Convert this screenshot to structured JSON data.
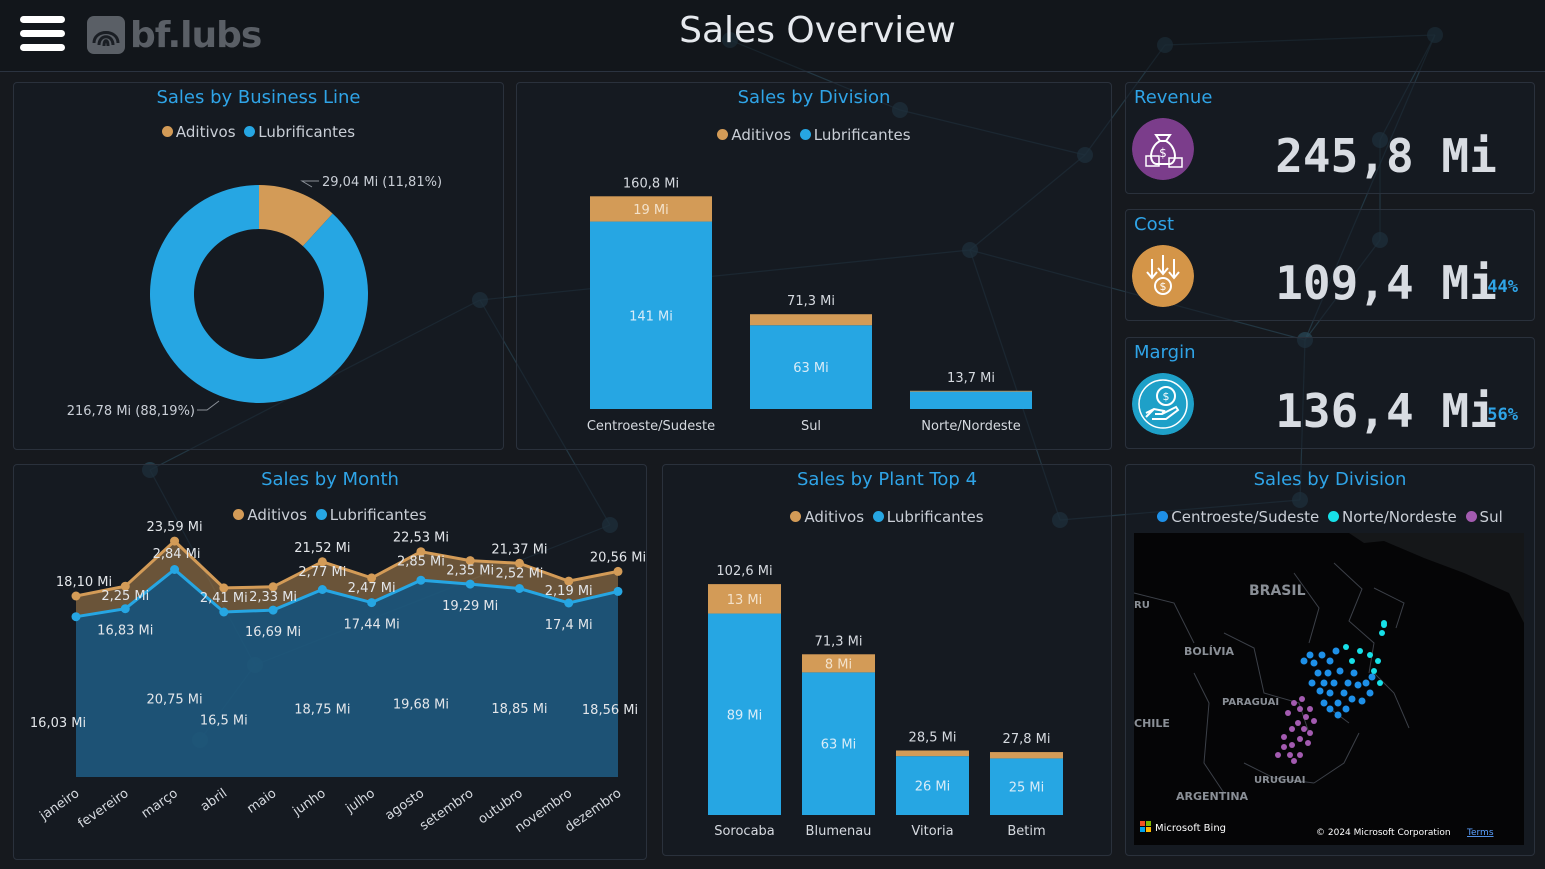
{
  "header": {
    "brand": "bf.lubs",
    "title": "Sales Overview"
  },
  "colors": {
    "aditivos": "#d39b57",
    "lubrificantes": "#26a6e3",
    "centroeste": "#1e90e8",
    "norte": "#17e0e8",
    "sul": "#a35bb0",
    "accent": "#2fa4e7",
    "revenue_icon": "#7b3d8b",
    "cost_icon": "#d49548",
    "margin_icon": "#1ea0c8"
  },
  "panels": {
    "business_line": {
      "title": "Sales by Business Line",
      "legend": [
        "Aditivos",
        "Lubrificantes"
      ]
    },
    "division_bar": {
      "title": "Sales by Division",
      "legend": [
        "Aditivos",
        "Lubrificantes"
      ]
    },
    "month": {
      "title": "Sales by Month",
      "legend": [
        "Aditivos",
        "Lubrificantes"
      ]
    },
    "plant": {
      "title": "Sales by Plant Top 4",
      "legend": [
        "Aditivos",
        "Lubrificantes"
      ]
    },
    "division_map": {
      "title": "Sales by Division",
      "legend": [
        "Centroeste/Sudeste",
        "Norte/Nordeste",
        "Sul"
      ],
      "labels": [
        "BRASIL",
        "BOLÍVIA",
        "PARAGUAI",
        "CHILE",
        "URUGUAI",
        "ARGENTINA",
        "RU"
      ],
      "brand": "Microsoft Bing",
      "copyright": "© 2024 Microsoft Corporation",
      "terms": "Terms"
    }
  },
  "kpis": {
    "revenue": {
      "title": "Revenue",
      "value": "245,8 Mi",
      "icon": "money-bag-icon"
    },
    "cost": {
      "title": "Cost",
      "value": "109,4 Mi",
      "pct": "44%",
      "icon": "coin-arrows-icon"
    },
    "margin": {
      "title": "Margin",
      "value": "136,4 Mi",
      "pct": "56%",
      "icon": "hand-coin-icon"
    }
  },
  "chart_data": [
    {
      "id": "business_line",
      "type": "pie",
      "title": "Sales by Business Line",
      "series": [
        {
          "name": "Aditivos",
          "value": 29.04,
          "label": "29,04 Mi (11,81%)"
        },
        {
          "name": "Lubrificantes",
          "value": 216.78,
          "label": "216,78 Mi (88,19%)"
        }
      ]
    },
    {
      "id": "division_bar",
      "type": "bar",
      "title": "Sales by Division",
      "categories": [
        "Centroeste/Sudeste",
        "Sul",
        "Norte/Nordeste"
      ],
      "series": [
        {
          "name": "Lubrificantes",
          "values": [
            141,
            63,
            13.1
          ],
          "labels": [
            "141 Mi",
            "63 Mi",
            ""
          ]
        },
        {
          "name": "Aditivos",
          "values": [
            19,
            8.3,
            0.6
          ],
          "labels": [
            "19 Mi",
            "",
            ""
          ]
        }
      ],
      "totals": [
        "160,8 Mi",
        "71,3 Mi",
        "13,7 Mi"
      ],
      "ylim": [
        0,
        170
      ]
    },
    {
      "id": "month",
      "type": "area",
      "title": "Sales by Month",
      "categories": [
        "janeiro",
        "fevereiro",
        "março",
        "abril",
        "maio",
        "junho",
        "julho",
        "agosto",
        "setembro",
        "outubro",
        "novembro",
        "dezembro"
      ],
      "series": [
        {
          "name": "Lubrificantes",
          "values": [
            16.03,
            16.83,
            20.75,
            16.5,
            16.69,
            18.75,
            17.44,
            19.68,
            19.29,
            18.85,
            17.4,
            18.56
          ],
          "labels": [
            "16,03 Mi",
            "16,83 Mi",
            "20,75 Mi",
            "16,5 Mi",
            "16,69 Mi",
            "18,75 Mi",
            "17,44 Mi",
            "19,68 Mi",
            "19,29 Mi",
            "18,85 Mi",
            "17,4 Mi",
            "18,56 Mi"
          ]
        },
        {
          "name": "Aditivos",
          "values": [
            2.07,
            2.25,
            2.84,
            2.41,
            2.33,
            2.77,
            2.47,
            2.85,
            2.35,
            2.52,
            2.19,
            2.0
          ],
          "labels": [
            "",
            "2,25 Mi",
            "2,84 Mi",
            "2,41 Mi",
            "2,33 Mi",
            "2,77 Mi",
            "2,47 Mi",
            "2,85 Mi",
            "2,35 Mi",
            "2,52 Mi",
            "2,19 Mi",
            ""
          ]
        }
      ],
      "totals": [
        18.1,
        19.08,
        23.59,
        18.91,
        19.02,
        21.52,
        19.91,
        22.53,
        21.64,
        21.37,
        19.59,
        20.56
      ],
      "total_labels": [
        "18,10 Mi",
        "",
        "23,59 Mi",
        "",
        "",
        "21,52 Mi",
        "",
        "22,53 Mi",
        "",
        "21,37 Mi",
        "",
        "20,56 Mi"
      ],
      "ylim": [
        0,
        25
      ]
    },
    {
      "id": "plant",
      "type": "bar",
      "title": "Sales by Plant Top 4",
      "categories": [
        "Sorocaba",
        "Blumenau",
        "Vitoria",
        "Betim"
      ],
      "series": [
        {
          "name": "Lubrificantes",
          "values": [
            89,
            63,
            26,
            25
          ],
          "labels": [
            "89 Mi",
            "63 Mi",
            "26 Mi",
            "25 Mi"
          ]
        },
        {
          "name": "Aditivos",
          "values": [
            13,
            8,
            2.5,
            2.8
          ],
          "labels": [
            "13 Mi",
            "8 Mi",
            "",
            ""
          ]
        }
      ],
      "totals": [
        "102,6 Mi",
        "71,3 Mi",
        "28,5 Mi",
        "27,8 Mi"
      ],
      "ylim": [
        0,
        110
      ]
    }
  ]
}
